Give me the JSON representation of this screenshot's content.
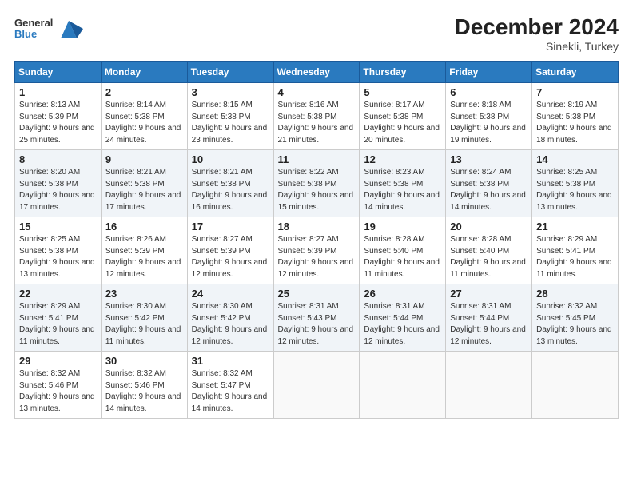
{
  "header": {
    "logo_line1": "General",
    "logo_line2": "Blue",
    "title": "December 2024",
    "subtitle": "Sinekli, Turkey"
  },
  "days_of_week": [
    "Sunday",
    "Monday",
    "Tuesday",
    "Wednesday",
    "Thursday",
    "Friday",
    "Saturday"
  ],
  "weeks": [
    [
      {
        "day": "1",
        "sunrise": "8:13 AM",
        "sunset": "5:39 PM",
        "daylight": "9 hours and 25 minutes."
      },
      {
        "day": "2",
        "sunrise": "8:14 AM",
        "sunset": "5:38 PM",
        "daylight": "9 hours and 24 minutes."
      },
      {
        "day": "3",
        "sunrise": "8:15 AM",
        "sunset": "5:38 PM",
        "daylight": "9 hours and 23 minutes."
      },
      {
        "day": "4",
        "sunrise": "8:16 AM",
        "sunset": "5:38 PM",
        "daylight": "9 hours and 21 minutes."
      },
      {
        "day": "5",
        "sunrise": "8:17 AM",
        "sunset": "5:38 PM",
        "daylight": "9 hours and 20 minutes."
      },
      {
        "day": "6",
        "sunrise": "8:18 AM",
        "sunset": "5:38 PM",
        "daylight": "9 hours and 19 minutes."
      },
      {
        "day": "7",
        "sunrise": "8:19 AM",
        "sunset": "5:38 PM",
        "daylight": "9 hours and 18 minutes."
      }
    ],
    [
      {
        "day": "8",
        "sunrise": "8:20 AM",
        "sunset": "5:38 PM",
        "daylight": "9 hours and 17 minutes."
      },
      {
        "day": "9",
        "sunrise": "8:21 AM",
        "sunset": "5:38 PM",
        "daylight": "9 hours and 17 minutes."
      },
      {
        "day": "10",
        "sunrise": "8:21 AM",
        "sunset": "5:38 PM",
        "daylight": "9 hours and 16 minutes."
      },
      {
        "day": "11",
        "sunrise": "8:22 AM",
        "sunset": "5:38 PM",
        "daylight": "9 hours and 15 minutes."
      },
      {
        "day": "12",
        "sunrise": "8:23 AM",
        "sunset": "5:38 PM",
        "daylight": "9 hours and 14 minutes."
      },
      {
        "day": "13",
        "sunrise": "8:24 AM",
        "sunset": "5:38 PM",
        "daylight": "9 hours and 14 minutes."
      },
      {
        "day": "14",
        "sunrise": "8:25 AM",
        "sunset": "5:38 PM",
        "daylight": "9 hours and 13 minutes."
      }
    ],
    [
      {
        "day": "15",
        "sunrise": "8:25 AM",
        "sunset": "5:38 PM",
        "daylight": "9 hours and 13 minutes."
      },
      {
        "day": "16",
        "sunrise": "8:26 AM",
        "sunset": "5:39 PM",
        "daylight": "9 hours and 12 minutes."
      },
      {
        "day": "17",
        "sunrise": "8:27 AM",
        "sunset": "5:39 PM",
        "daylight": "9 hours and 12 minutes."
      },
      {
        "day": "18",
        "sunrise": "8:27 AM",
        "sunset": "5:39 PM",
        "daylight": "9 hours and 12 minutes."
      },
      {
        "day": "19",
        "sunrise": "8:28 AM",
        "sunset": "5:40 PM",
        "daylight": "9 hours and 11 minutes."
      },
      {
        "day": "20",
        "sunrise": "8:28 AM",
        "sunset": "5:40 PM",
        "daylight": "9 hours and 11 minutes."
      },
      {
        "day": "21",
        "sunrise": "8:29 AM",
        "sunset": "5:41 PM",
        "daylight": "9 hours and 11 minutes."
      }
    ],
    [
      {
        "day": "22",
        "sunrise": "8:29 AM",
        "sunset": "5:41 PM",
        "daylight": "9 hours and 11 minutes."
      },
      {
        "day": "23",
        "sunrise": "8:30 AM",
        "sunset": "5:42 PM",
        "daylight": "9 hours and 11 minutes."
      },
      {
        "day": "24",
        "sunrise": "8:30 AM",
        "sunset": "5:42 PM",
        "daylight": "9 hours and 12 minutes."
      },
      {
        "day": "25",
        "sunrise": "8:31 AM",
        "sunset": "5:43 PM",
        "daylight": "9 hours and 12 minutes."
      },
      {
        "day": "26",
        "sunrise": "8:31 AM",
        "sunset": "5:44 PM",
        "daylight": "9 hours and 12 minutes."
      },
      {
        "day": "27",
        "sunrise": "8:31 AM",
        "sunset": "5:44 PM",
        "daylight": "9 hours and 12 minutes."
      },
      {
        "day": "28",
        "sunrise": "8:32 AM",
        "sunset": "5:45 PM",
        "daylight": "9 hours and 13 minutes."
      }
    ],
    [
      {
        "day": "29",
        "sunrise": "8:32 AM",
        "sunset": "5:46 PM",
        "daylight": "9 hours and 13 minutes."
      },
      {
        "day": "30",
        "sunrise": "8:32 AM",
        "sunset": "5:46 PM",
        "daylight": "9 hours and 14 minutes."
      },
      {
        "day": "31",
        "sunrise": "8:32 AM",
        "sunset": "5:47 PM",
        "daylight": "9 hours and 14 minutes."
      },
      null,
      null,
      null,
      null
    ]
  ],
  "labels": {
    "sunrise": "Sunrise:",
    "sunset": "Sunset:",
    "daylight": "Daylight:"
  }
}
